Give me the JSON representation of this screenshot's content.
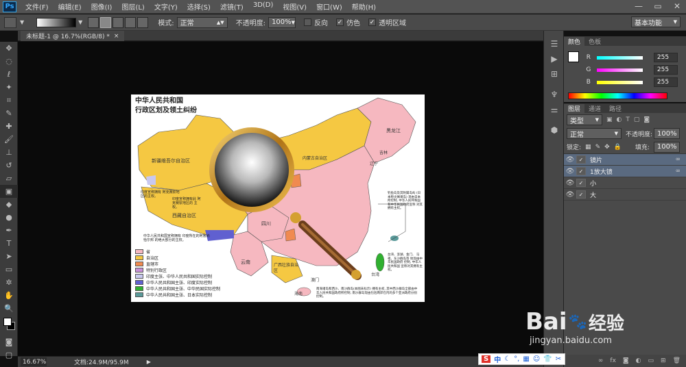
{
  "app": {
    "logo": "Ps"
  },
  "menu": [
    "文件(F)",
    "编辑(E)",
    "图像(I)",
    "图层(L)",
    "文字(Y)",
    "选择(S)",
    "滤镜(T)",
    "3D(D)",
    "视图(V)",
    "窗口(W)",
    "帮助(H)"
  ],
  "window_controls": [
    "—",
    "▭",
    "✕"
  ],
  "options_bar": {
    "mode_label": "模式:",
    "mode_value": "正常",
    "opacity_label": "不透明度:",
    "opacity_value": "100%",
    "reverse_label": "反向",
    "dither_label": "仿色",
    "transparency_label": "透明区域",
    "workspace": "基本功能"
  },
  "document": {
    "tab_title": "未标题-1 @ 16.7%(RGB/8) *",
    "close": "×"
  },
  "status": {
    "zoom": "16.67%",
    "doc_info": "文档:24.9M/95.9M"
  },
  "color_panel": {
    "tabs": [
      "颜色",
      "色板"
    ],
    "channels": [
      {
        "label": "R",
        "value": "255",
        "color": "#ff3030"
      },
      {
        "label": "G",
        "value": "255",
        "color": "#30e030"
      },
      {
        "label": "B",
        "value": "255",
        "color": "#3050ff"
      }
    ]
  },
  "layers_panel": {
    "tabs": [
      "图层",
      "通道",
      "路径"
    ],
    "filter_label": "类型",
    "blend_mode": "正常",
    "opacity_label": "不透明度:",
    "opacity_value": "100%",
    "lock_label": "锁定:",
    "fill_label": "填充:",
    "fill_value": "100%",
    "layers": [
      {
        "name": "镜片",
        "selected": true,
        "linked": true
      },
      {
        "name": "1放大镜",
        "selected": true,
        "linked": true
      },
      {
        "name": "小",
        "selected": false,
        "linked": false
      },
      {
        "name": "大",
        "selected": false,
        "linked": false
      }
    ]
  },
  "map": {
    "title_line1": "中华人民共和国",
    "title_line2": "行政区划及领土纠纷",
    "regions": [
      "新疆维吾尔自治区",
      "西藏自治区",
      "内蒙古自治区",
      "黑龙江",
      "吉林",
      "辽宁",
      "四川",
      "云南",
      "广西壮族自治区",
      "海南",
      "澳门",
      "台湾"
    ],
    "legend": [
      "省",
      "自治区",
      "直辖市",
      "特别行政区",
      "印度主张、中华人民共和国实际控制",
      "中华人民共和国主张、印度实际控制",
      "中华人民共和国主张、中华民国实际控制",
      "中华人民共和国主张、日本实际控制"
    ],
    "legend_colors": [
      "#f6b8c0",
      "#f5c842",
      "#f08a50",
      "#c890d8",
      "#c8c8f0",
      "#6060d0",
      "#30b030",
      "#5a9a9a"
    ],
    "note_india": "印度宣称拥有 阿克赛钦地区的主权。",
    "note_tibet": "印度宣称拥有此 阿克赛钦地区的 主权。",
    "note_south": "中华人民共和国宣称拥有 印度所在的阿鲁纳恰尔邦 的绝大部分的主权。",
    "note_diaoyu": "钓鱼岛及其附属岛屿 (日本称尖阁诸岛) 现由日本所控制, 中华人民共和国 和中华民国政府宣称 对其拥有主权。",
    "note_taiwan": "台湾、澎湖、金门、 马祖、东沙群岛等 地现由中华民国政府 控制, 中华人民共和国 宣称对其拥有主权。",
    "note_bottom": "南海诸岛和西沙、南沙群岛(本图未标示) 拥有主权, 其中西沙群岛全部由中华人民共和国政府所控制, 南沙群岛现由包括两岸在内的多个亚洲政府分别控制。"
  },
  "ime": {
    "label": "中"
  },
  "watermark": {
    "brand": "Bai",
    "sub": "经验",
    "url": "jingyan.baidu.com"
  }
}
